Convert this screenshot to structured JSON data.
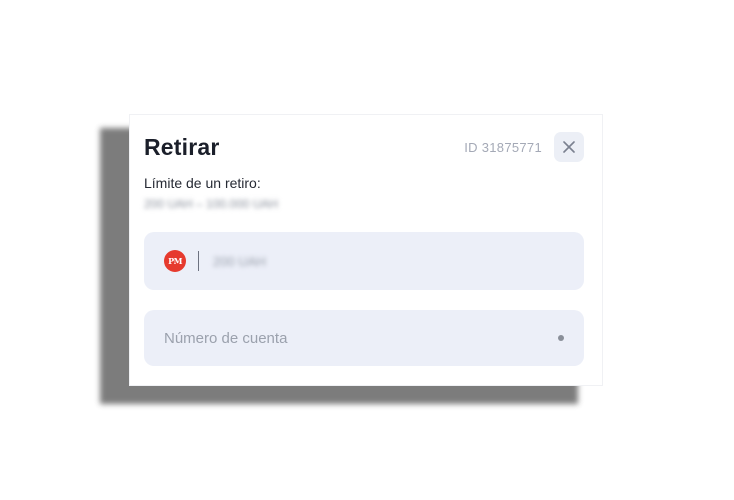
{
  "modal": {
    "title": "Retirar",
    "id_label": "ID 31875771",
    "close_icon": "close-icon",
    "limit": {
      "label": "Límite de un retiro:",
      "value": "200 UAH – 100.000 UAH"
    },
    "amount_field": {
      "payment_logo_text": "PM",
      "payment_logo_color": "#e63a2e",
      "value": "200 UAH"
    },
    "account_field": {
      "placeholder": "Número de cuenta",
      "value": ""
    }
  }
}
